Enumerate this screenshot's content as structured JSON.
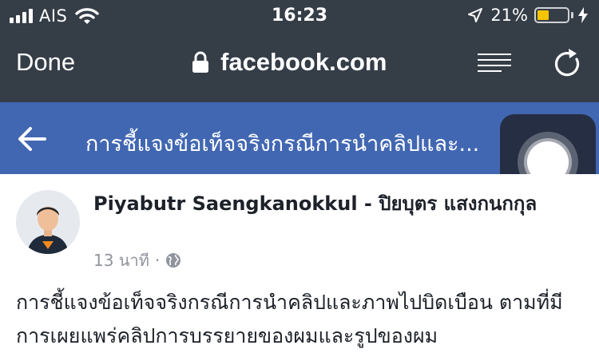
{
  "status_bar": {
    "carrier": "AIS",
    "time": "16:23",
    "battery_percent": "21%",
    "battery_level": 0.21,
    "battery_color": "#f7c500"
  },
  "browser_bar": {
    "done_label": "Done",
    "url": "facebook.com",
    "icons": [
      "lock-icon",
      "reader-icon",
      "reload-icon"
    ]
  },
  "fb_header": {
    "title": "การชี้แจงข้อเท็จจริงกรณีการนำคลิปและ...",
    "background": "#4267b2"
  },
  "post": {
    "author": "Piyabutr Saengkanokkul - ปิยบุตร แสงกนกกุล",
    "time": "13 นาที",
    "privacy_icon": "globe-icon",
    "text": "การชี้แจงข้อเท็จจริงกรณีการนำคลิปและภาพไปบิดเบือน ตามที่มีการเผยแพร่คลิปการบรรยายของผมและรูปของผม"
  },
  "colors": {
    "chrome": "#353d47",
    "fb_blue": "#4267b2",
    "meta_gray": "#90949c"
  }
}
